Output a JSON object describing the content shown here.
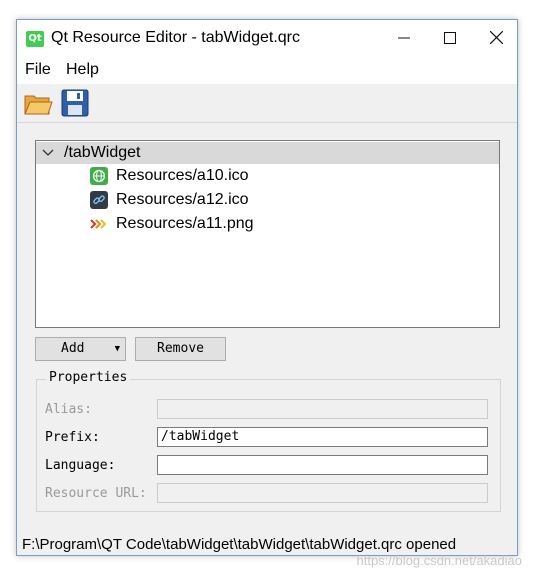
{
  "window": {
    "app_icon_text": "Qt",
    "title": "Qt Resource Editor - tabWidget.qrc",
    "controls": {
      "minimize": "—",
      "maximize": "☐",
      "close": "✕"
    }
  },
  "menu": {
    "items": [
      {
        "label": "File"
      },
      {
        "label": "Help"
      }
    ]
  },
  "toolbar": {
    "icons": [
      "open-folder-icon",
      "save-disk-icon"
    ]
  },
  "tree": {
    "root": {
      "label": "/tabWidget",
      "expander": "∨"
    },
    "files": [
      {
        "label": "Resources/a10.ico",
        "icon": "globe-icon"
      },
      {
        "label": "Resources/a12.ico",
        "icon": "link-icon"
      },
      {
        "label": "Resources/a11.png",
        "icon": "arrows-icon"
      }
    ]
  },
  "buttons": {
    "add": "Add",
    "add_arrow": "▼",
    "remove": "Remove"
  },
  "properties": {
    "title": "Properties",
    "alias": {
      "label": "Alias:",
      "value": ""
    },
    "prefix": {
      "label": "Prefix:",
      "value": "/tabWidget"
    },
    "language": {
      "label": "Language:",
      "value": ""
    },
    "resource_url": {
      "label": "Resource URL:",
      "value": ""
    }
  },
  "status": "F:\\Program\\QT Code\\tabWidget\\tabWidget\\tabWidget.qrc opened",
  "watermark": "https://blog.csdn.net/akadiao",
  "colors": {
    "accent_qt": "#41cd52",
    "selection": "#d9d9d9",
    "window_bg": "#f0f0f0"
  }
}
